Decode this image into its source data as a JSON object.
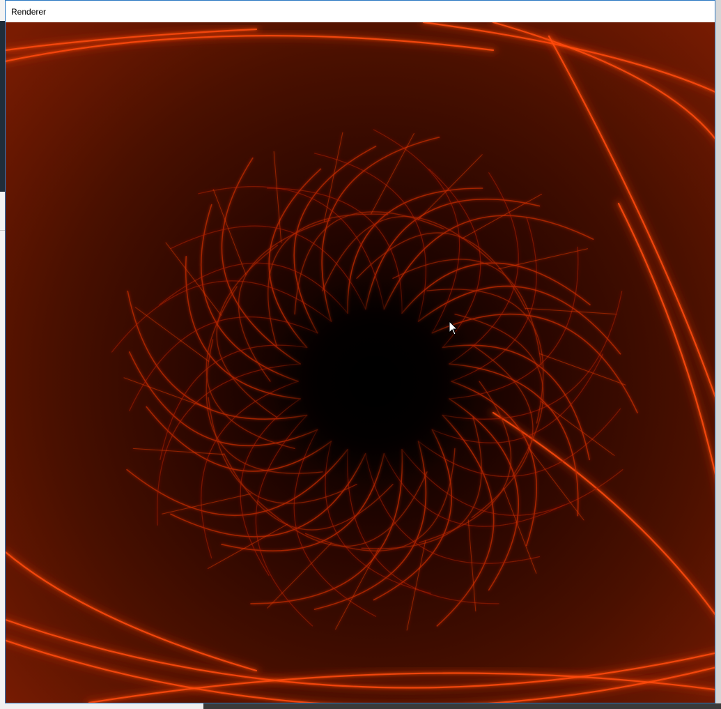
{
  "window": {
    "title": "Renderer"
  },
  "render": {
    "description_colors": {
      "background": "#5a1400",
      "center": "#000000",
      "glow": "#ff3a0a",
      "curve": "#c02a05"
    }
  },
  "cursor": {
    "icon": "arrow-cursor-icon"
  }
}
